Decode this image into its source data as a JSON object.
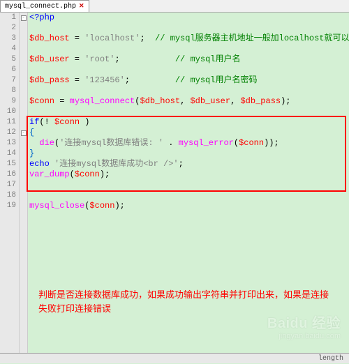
{
  "tab": {
    "filename": "mysql_connect.php"
  },
  "lines": [
    {
      "n": "1",
      "fold": "box",
      "raw": "<?php",
      "tokens": [
        {
          "c": "kw",
          "t": "<?php"
        }
      ]
    },
    {
      "n": "2",
      "fold": "",
      "raw": "",
      "tokens": []
    },
    {
      "n": "3",
      "fold": "",
      "raw": "$db_host = 'localhost';  // mysql服务器主机地址一般加localhost就可以",
      "tokens": [
        {
          "c": "var",
          "t": "$db_host"
        },
        {
          "c": "punct",
          "t": " = "
        },
        {
          "c": "str",
          "t": "'localhost'"
        },
        {
          "c": "punct",
          "t": ";  "
        },
        {
          "c": "comment",
          "t": "// mysql服务器主机地址一般加localhost就可以"
        }
      ]
    },
    {
      "n": "4",
      "fold": "",
      "raw": "",
      "tokens": []
    },
    {
      "n": "5",
      "fold": "",
      "raw": "$db_user = 'root';           // mysql用户名",
      "tokens": [
        {
          "c": "var",
          "t": "$db_user"
        },
        {
          "c": "punct",
          "t": " = "
        },
        {
          "c": "str",
          "t": "'root'"
        },
        {
          "c": "punct",
          "t": ";           "
        },
        {
          "c": "comment",
          "t": "// mysql用户名"
        }
      ]
    },
    {
      "n": "6",
      "fold": "",
      "raw": "",
      "tokens": []
    },
    {
      "n": "7",
      "fold": "",
      "raw": "$db_pass = '123456';         // mysql用户名密码",
      "tokens": [
        {
          "c": "var",
          "t": "$db_pass"
        },
        {
          "c": "punct",
          "t": " = "
        },
        {
          "c": "str",
          "t": "'123456'"
        },
        {
          "c": "punct",
          "t": ";         "
        },
        {
          "c": "comment",
          "t": "// mysql用户名密码"
        }
      ]
    },
    {
      "n": "8",
      "fold": "",
      "raw": "",
      "tokens": []
    },
    {
      "n": "9",
      "fold": "",
      "raw": "$conn = mysql_connect($db_host, $db_user, $db_pass);",
      "tokens": [
        {
          "c": "var",
          "t": "$conn"
        },
        {
          "c": "punct",
          "t": " = "
        },
        {
          "c": "func",
          "t": "mysql_connect"
        },
        {
          "c": "punct",
          "t": "("
        },
        {
          "c": "var",
          "t": "$db_host"
        },
        {
          "c": "punct",
          "t": ", "
        },
        {
          "c": "var",
          "t": "$db_user"
        },
        {
          "c": "punct",
          "t": ", "
        },
        {
          "c": "var",
          "t": "$db_pass"
        },
        {
          "c": "punct",
          "t": ");"
        }
      ]
    },
    {
      "n": "10",
      "fold": "",
      "raw": "",
      "tokens": []
    },
    {
      "n": "11",
      "fold": "",
      "raw": "if(! $conn )",
      "tokens": [
        {
          "c": "kw",
          "t": "if"
        },
        {
          "c": "punct",
          "t": "(! "
        },
        {
          "c": "var",
          "t": "$conn"
        },
        {
          "c": "punct",
          "t": " )"
        }
      ]
    },
    {
      "n": "12",
      "fold": "box",
      "raw": "{",
      "tokens": [
        {
          "c": "blue",
          "t": "{"
        }
      ]
    },
    {
      "n": "13",
      "fold": "",
      "raw": "  die('连接mysql数据库错误: ' . mysql_error($conn));",
      "tokens": [
        {
          "c": "punct",
          "t": "  "
        },
        {
          "c": "func",
          "t": "die"
        },
        {
          "c": "punct",
          "t": "("
        },
        {
          "c": "str",
          "t": "'连接mysql数据库错误: '"
        },
        {
          "c": "punct",
          "t": " . "
        },
        {
          "c": "func",
          "t": "mysql_error"
        },
        {
          "c": "punct",
          "t": "("
        },
        {
          "c": "var",
          "t": "$conn"
        },
        {
          "c": "punct",
          "t": "));"
        }
      ]
    },
    {
      "n": "14",
      "fold": "",
      "raw": "}",
      "tokens": [
        {
          "c": "blue",
          "t": "}"
        }
      ]
    },
    {
      "n": "15",
      "fold": "",
      "raw": "echo '连接mysql数据库成功<br />';",
      "tokens": [
        {
          "c": "kw",
          "t": "echo"
        },
        {
          "c": "punct",
          "t": " "
        },
        {
          "c": "str",
          "t": "'连接mysql数据库成功<br />'"
        },
        {
          "c": "punct",
          "t": ";"
        }
      ]
    },
    {
      "n": "16",
      "fold": "",
      "raw": "var_dump($conn);",
      "tokens": [
        {
          "c": "func",
          "t": "var_dump"
        },
        {
          "c": "punct",
          "t": "("
        },
        {
          "c": "var",
          "t": "$conn"
        },
        {
          "c": "punct",
          "t": ");"
        }
      ]
    },
    {
      "n": "17",
      "fold": "",
      "raw": "",
      "tokens": []
    },
    {
      "n": "18",
      "fold": "",
      "raw": "",
      "tokens": []
    },
    {
      "n": "19",
      "fold": "",
      "raw": "mysql_close($conn);",
      "tokens": [
        {
          "c": "func",
          "t": "mysql_close"
        },
        {
          "c": "punct",
          "t": "("
        },
        {
          "c": "var",
          "t": "$conn"
        },
        {
          "c": "punct",
          "t": ");"
        }
      ]
    }
  ],
  "red_box": {
    "top_line": 11,
    "bottom_line": 17
  },
  "annotation": "判断是否连接数据库成功，如果成功输出字符串并打印出来，如果是连接失败打印连接错误",
  "status": {
    "label": "length"
  },
  "watermark": {
    "brand": "Baidu 经验",
    "url": "jingyan.baidu.com"
  }
}
